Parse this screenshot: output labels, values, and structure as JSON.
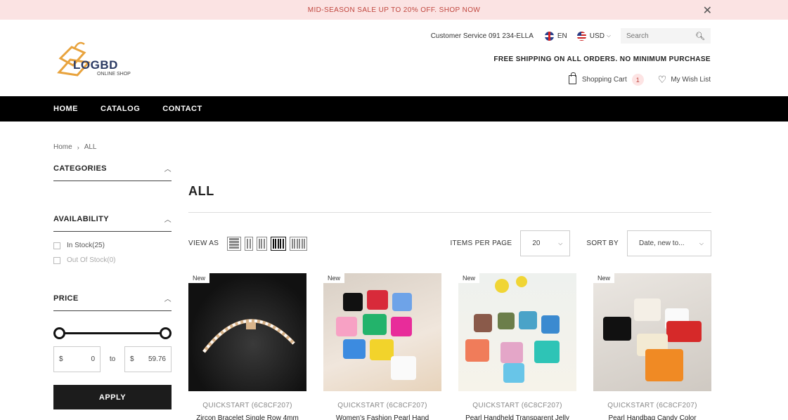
{
  "announcement": {
    "text": "MID-SEASON SALE UP TO 20% OFF. SHOP NOW"
  },
  "logo": {
    "word": "LOGBD",
    "sub": "ONLINE SHOP"
  },
  "topbar": {
    "customer_service": "Customer Service 091 234-ELLA",
    "language": "EN",
    "currency": "USD",
    "search_placeholder": "Search"
  },
  "free_shipping": "FREE SHIPPING ON ALL ORDERS. NO MINIMUM PURCHASE",
  "cart": {
    "label": "Shopping Cart",
    "count": "1"
  },
  "wishlist": {
    "label": "My Wish List"
  },
  "nav": {
    "items": [
      "HOME",
      "CATALOG",
      "CONTACT"
    ]
  },
  "breadcrumb": {
    "home": "Home",
    "current": "ALL"
  },
  "sidebar": {
    "categories_title": "CATEGORIES",
    "availability_title": "AVAILABILITY",
    "in_stock": "In Stock(25)",
    "out_of_stock": "Out Of Stock(0)",
    "price_title": "PRICE",
    "currency_symbol": "$",
    "price_min": "0",
    "price_to": "to",
    "price_max": "59.76",
    "apply_label": "APPLY"
  },
  "collection": {
    "title": "ALL"
  },
  "toolbar": {
    "view_as": "VIEW AS",
    "items_per_page_label": "ITEMS PER PAGE",
    "items_per_page_value": "20",
    "sort_label": "SORT BY",
    "sort_value": "Date, new to..."
  },
  "products": [
    {
      "tag": "New",
      "quickstart": "QUICKSTART (6C8CF207)",
      "name": "Zircon Bracelet Single Row 4mm"
    },
    {
      "tag": "New",
      "quickstart": "QUICKSTART (6C8CF207)",
      "name": "Women's Fashion Pearl Hand"
    },
    {
      "tag": "New",
      "quickstart": "QUICKSTART (6C8CF207)",
      "name": "Pearl Handheld Transparent Jelly"
    },
    {
      "tag": "New",
      "quickstart": "QUICKSTART (6C8CF207)",
      "name": "Pearl Handbag Candy Color"
    }
  ],
  "colors": {
    "announce_bg": "#fbe3e3",
    "announce_text": "#c0463e",
    "nav_bg": "#000000",
    "logo_orange": "#e8a33d",
    "logo_navy": "#2b3a63"
  }
}
